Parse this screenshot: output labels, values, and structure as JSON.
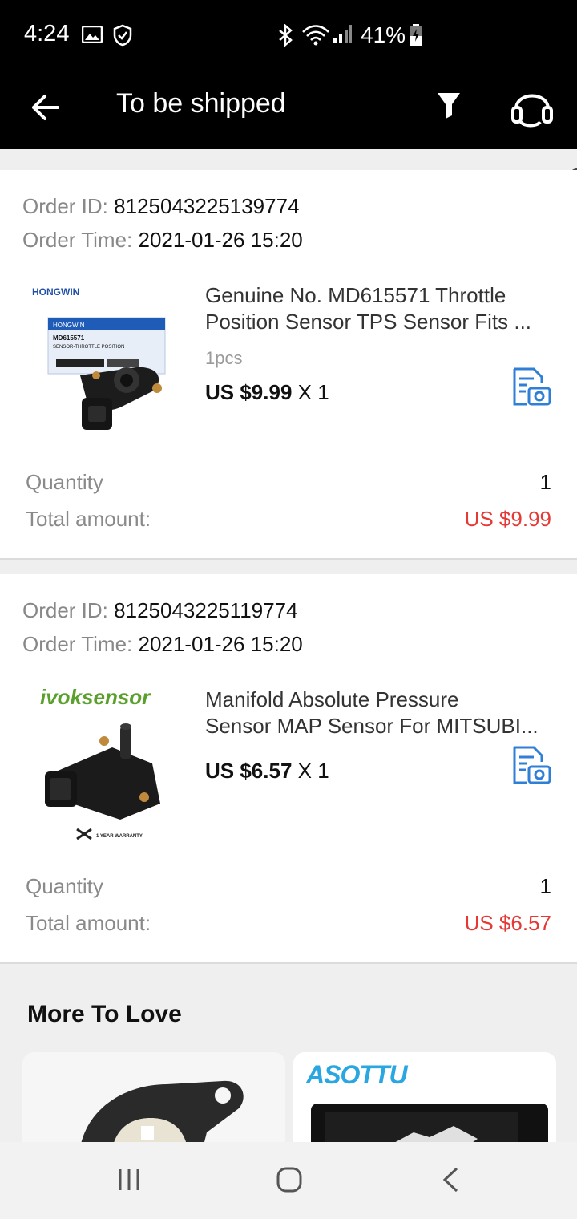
{
  "status_bar": {
    "time": "4:24",
    "battery": "41%"
  },
  "header": {
    "title": "To be shipped"
  },
  "orders": [
    {
      "id_label": "Order ID:",
      "id": "8125043225139774",
      "time_label": "Order Time:",
      "time": "2021-01-26 15:20",
      "product_title_line1": "Genuine No. MD615571 Throttle",
      "product_title_line2": "Position Sensor TPS Sensor Fits ...",
      "spec": "1pcs",
      "price": "US $9.99",
      "qty_text": "X 1",
      "quantity_label": "Quantity",
      "quantity": "1",
      "total_label": "Total amount:",
      "total": "US $9.99",
      "image_brand": "HONGWIN",
      "image_label": "MD615571",
      "image_sub": "SENSOR-THROTTLE POSITION"
    },
    {
      "id_label": "Order ID:",
      "id": "8125043225119774",
      "time_label": "Order Time:",
      "time": "2021-01-26 15:20",
      "product_title_line1": "Manifold Absolute Pressure",
      "product_title_line2": "Sensor MAP Sensor For MITSUBI...",
      "price": "US $6.57",
      "qty_text": "X 1",
      "quantity_label": "Quantity",
      "quantity": "1",
      "total_label": "Total amount:",
      "total": "US $6.57",
      "image_brand": "ivoksensor",
      "image_warranty": "1 YEAR WARRANTY"
    }
  ],
  "more_to_love": {
    "title": "More To Love",
    "right_brand": "ASOTTU"
  },
  "colors": {
    "header_bg": "#000000",
    "price_red": "#e53935",
    "icon_blue": "#2f7fd6",
    "label_gray": "#888888"
  },
  "icons": {
    "back": "arrow-left-icon",
    "filter": "filter-funnel-icon",
    "support": "headset-icon",
    "snapshot": "document-camera-icon"
  }
}
